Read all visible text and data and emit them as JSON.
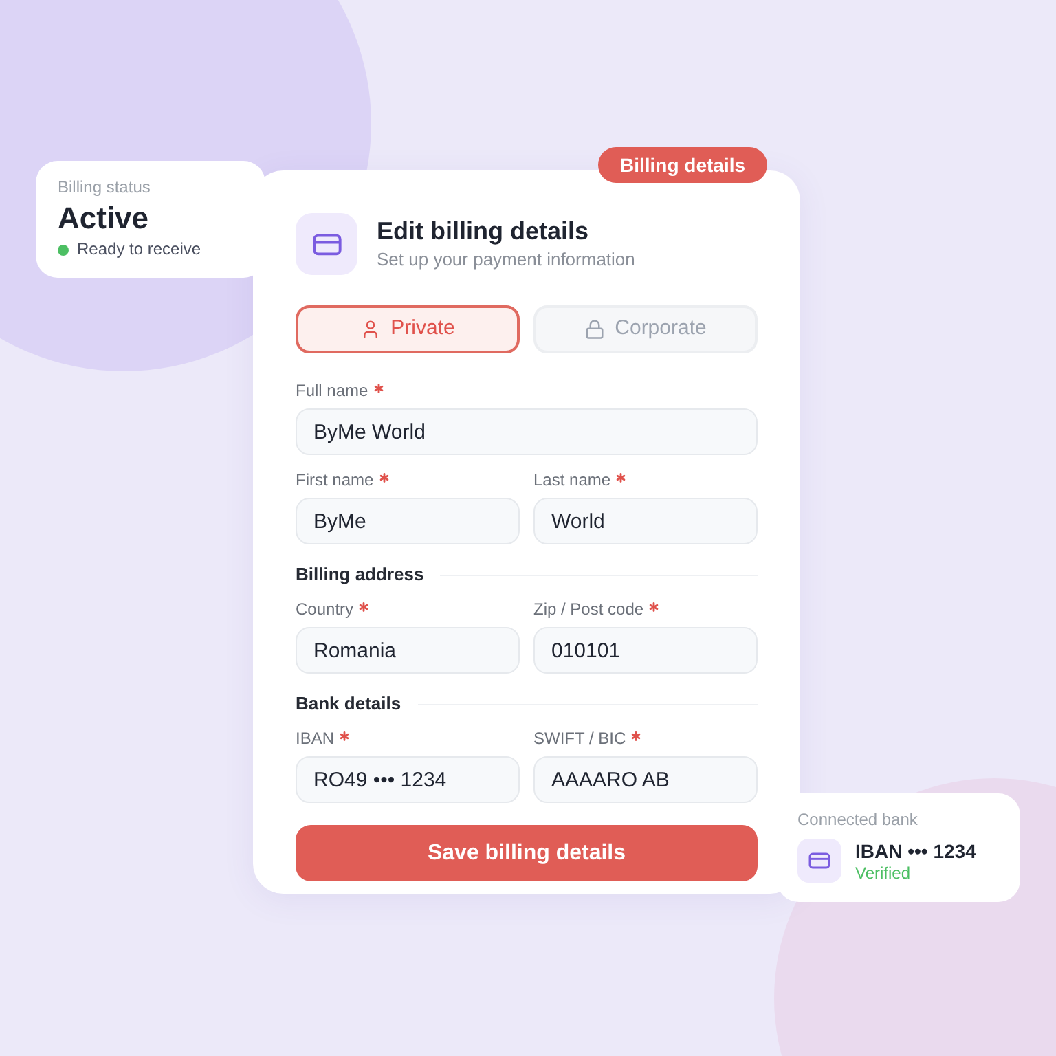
{
  "status_card": {
    "label": "Billing status",
    "value": "Active",
    "status": "Ready to receive"
  },
  "badge": "Billing details",
  "form": {
    "title": "Edit billing details",
    "subtitle": "Set up your payment information",
    "account_types": [
      {
        "label": "Private",
        "selected": true
      },
      {
        "label": "Corporate",
        "selected": false
      }
    ],
    "rows": [
      {
        "kind": "fields",
        "fields": [
          {
            "label": "Full name",
            "required": true,
            "value": "ByMe World"
          }
        ]
      },
      {
        "kind": "fields",
        "fields": [
          {
            "label": "First name",
            "required": true,
            "value": "ByMe"
          },
          {
            "label": "Last name",
            "required": true,
            "value": "World"
          }
        ]
      },
      {
        "kind": "heading",
        "text": "Billing address"
      },
      {
        "kind": "fields",
        "fields": [
          {
            "label": "Country",
            "required": true,
            "value": "Romania"
          },
          {
            "label": "Zip / Post code",
            "required": true,
            "value": "010101"
          }
        ]
      },
      {
        "kind": "heading",
        "text": "Bank details"
      },
      {
        "kind": "fields",
        "fields": [
          {
            "label": "IBAN",
            "required": true,
            "value": "RO49 ••• 1234"
          },
          {
            "label": "SWIFT / BIC",
            "required": true,
            "value": "AAAARO AB"
          }
        ]
      }
    ],
    "submit": "Save billing details"
  },
  "connected_bank": {
    "label": "Connected bank",
    "account": "IBAN ••• 1234",
    "status": "Verified"
  }
}
